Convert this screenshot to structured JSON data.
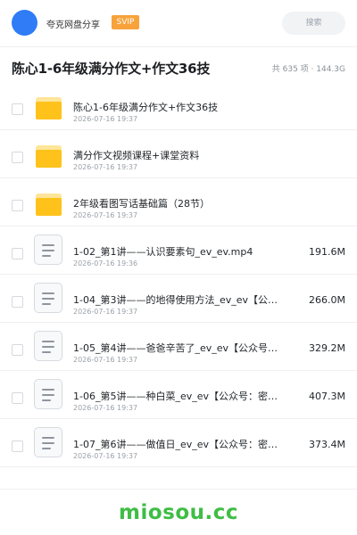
{
  "header": {
    "username": "夸克网盘分享",
    "badge": "SVIP",
    "search_placeholder": "搜索"
  },
  "folder_title": "陈心1-6年级满分作文+作文36技",
  "summary": "共 635 项 · 144.3G",
  "items": [
    {
      "type": "folder",
      "name": "陈心1-6年级满分作文+作文36技",
      "date": "2026-07-16 19:37",
      "size": ""
    },
    {
      "type": "folder",
      "name": "满分作文视频课程+课堂资料",
      "date": "2026-07-16 19:37",
      "size": ""
    },
    {
      "type": "folder",
      "name": "2年级看图写话基础篇（28节）",
      "date": "2026-07-16 19:37",
      "size": ""
    },
    {
      "type": "file",
      "name": "1-02_第1讲——认识要素句_ev_ev.mp4",
      "date": "2026-07-16 19:36",
      "size": "191.6M"
    },
    {
      "type": "file",
      "name": "1-04_第3讲——的地得使用方法_ev_ev【公…",
      "date": "2026-07-16 19:37",
      "size": "266.0M"
    },
    {
      "type": "file",
      "name": "1-05_第4讲——爸爸辛苦了_ev_ev【公众号…",
      "date": "2026-07-16 19:37",
      "size": "329.2M"
    },
    {
      "type": "file",
      "name": "1-06_第5讲——种白菜_ev_ev【公众号：密…",
      "date": "2026-07-16 19:37",
      "size": "407.3M"
    },
    {
      "type": "file",
      "name": "1-07_第6讲——做值日_ev_ev【公众号：密…",
      "date": "2026-07-16 19:37",
      "size": "373.4M"
    }
  ],
  "watermark": "miosou.cc",
  "colors": {
    "avatar": "#2f7cf6",
    "badge": "#f7a23a",
    "folder": "#ffc21a",
    "watermark": "#3fbd45"
  }
}
